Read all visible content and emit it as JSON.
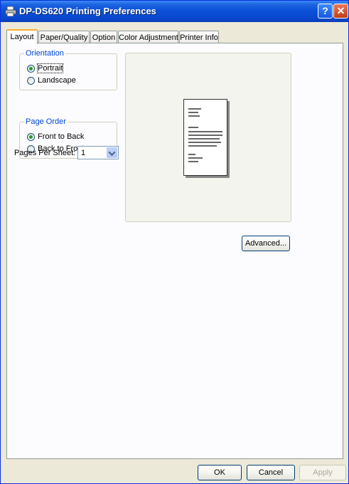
{
  "window": {
    "title": "DP-DS620 Printing Preferences",
    "help_symbol": "?",
    "close_symbol": "✕",
    "icon": "printer-icon",
    "accent": "#0a4fd6"
  },
  "tabs": [
    {
      "label": "Layout",
      "active": true
    },
    {
      "label": "Paper/Quality",
      "active": false
    },
    {
      "label": "Option",
      "active": false
    },
    {
      "label": "Color Adjustment",
      "active": false
    },
    {
      "label": "Printer Info",
      "active": false
    }
  ],
  "orientation": {
    "legend": "Orientation",
    "portrait": "Portrait",
    "landscape": "Landscape",
    "selected": "Portrait"
  },
  "page_order": {
    "legend": "Page Order",
    "front_to_back": "Front to Back",
    "back_to_front": "Back to Front",
    "selected": "Front to Back"
  },
  "pages_per_sheet": {
    "label": "Pages Per Sheet:",
    "value": "1"
  },
  "buttons": {
    "advanced": "Advanced...",
    "ok": "OK",
    "cancel": "Cancel",
    "apply": "Apply"
  }
}
